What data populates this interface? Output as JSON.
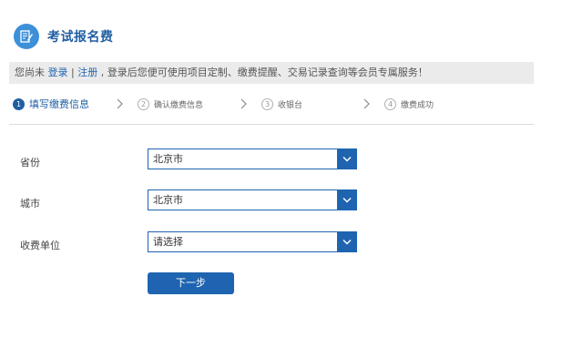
{
  "header": {
    "title": "考试报名费",
    "icon": "form-edit-icon"
  },
  "notice": {
    "prefix": "您尚未 ",
    "login_link": "登录",
    "separator": " | ",
    "register_link": "注册",
    "suffix": " , 登录后您便可使用项目定制、缴费提醒、交易记录查询等会员专属服务！"
  },
  "steps": [
    {
      "num": "1",
      "label": "填写缴费信息",
      "active": true
    },
    {
      "num": "2",
      "label": "确认缴费信息",
      "active": false
    },
    {
      "num": "3",
      "label": "收银台",
      "active": false
    },
    {
      "num": "4",
      "label": "缴费成功",
      "active": false
    }
  ],
  "form": {
    "province": {
      "label": "省份",
      "value": "北京市"
    },
    "city": {
      "label": "城市",
      "value": "北京市"
    },
    "unit": {
      "label": "收费单位",
      "value": "请选择"
    },
    "next_button": "下一步"
  },
  "colors": {
    "brand": "#1f64b0",
    "title": "#1f5fa3",
    "notice_bg": "#ebebeb"
  }
}
